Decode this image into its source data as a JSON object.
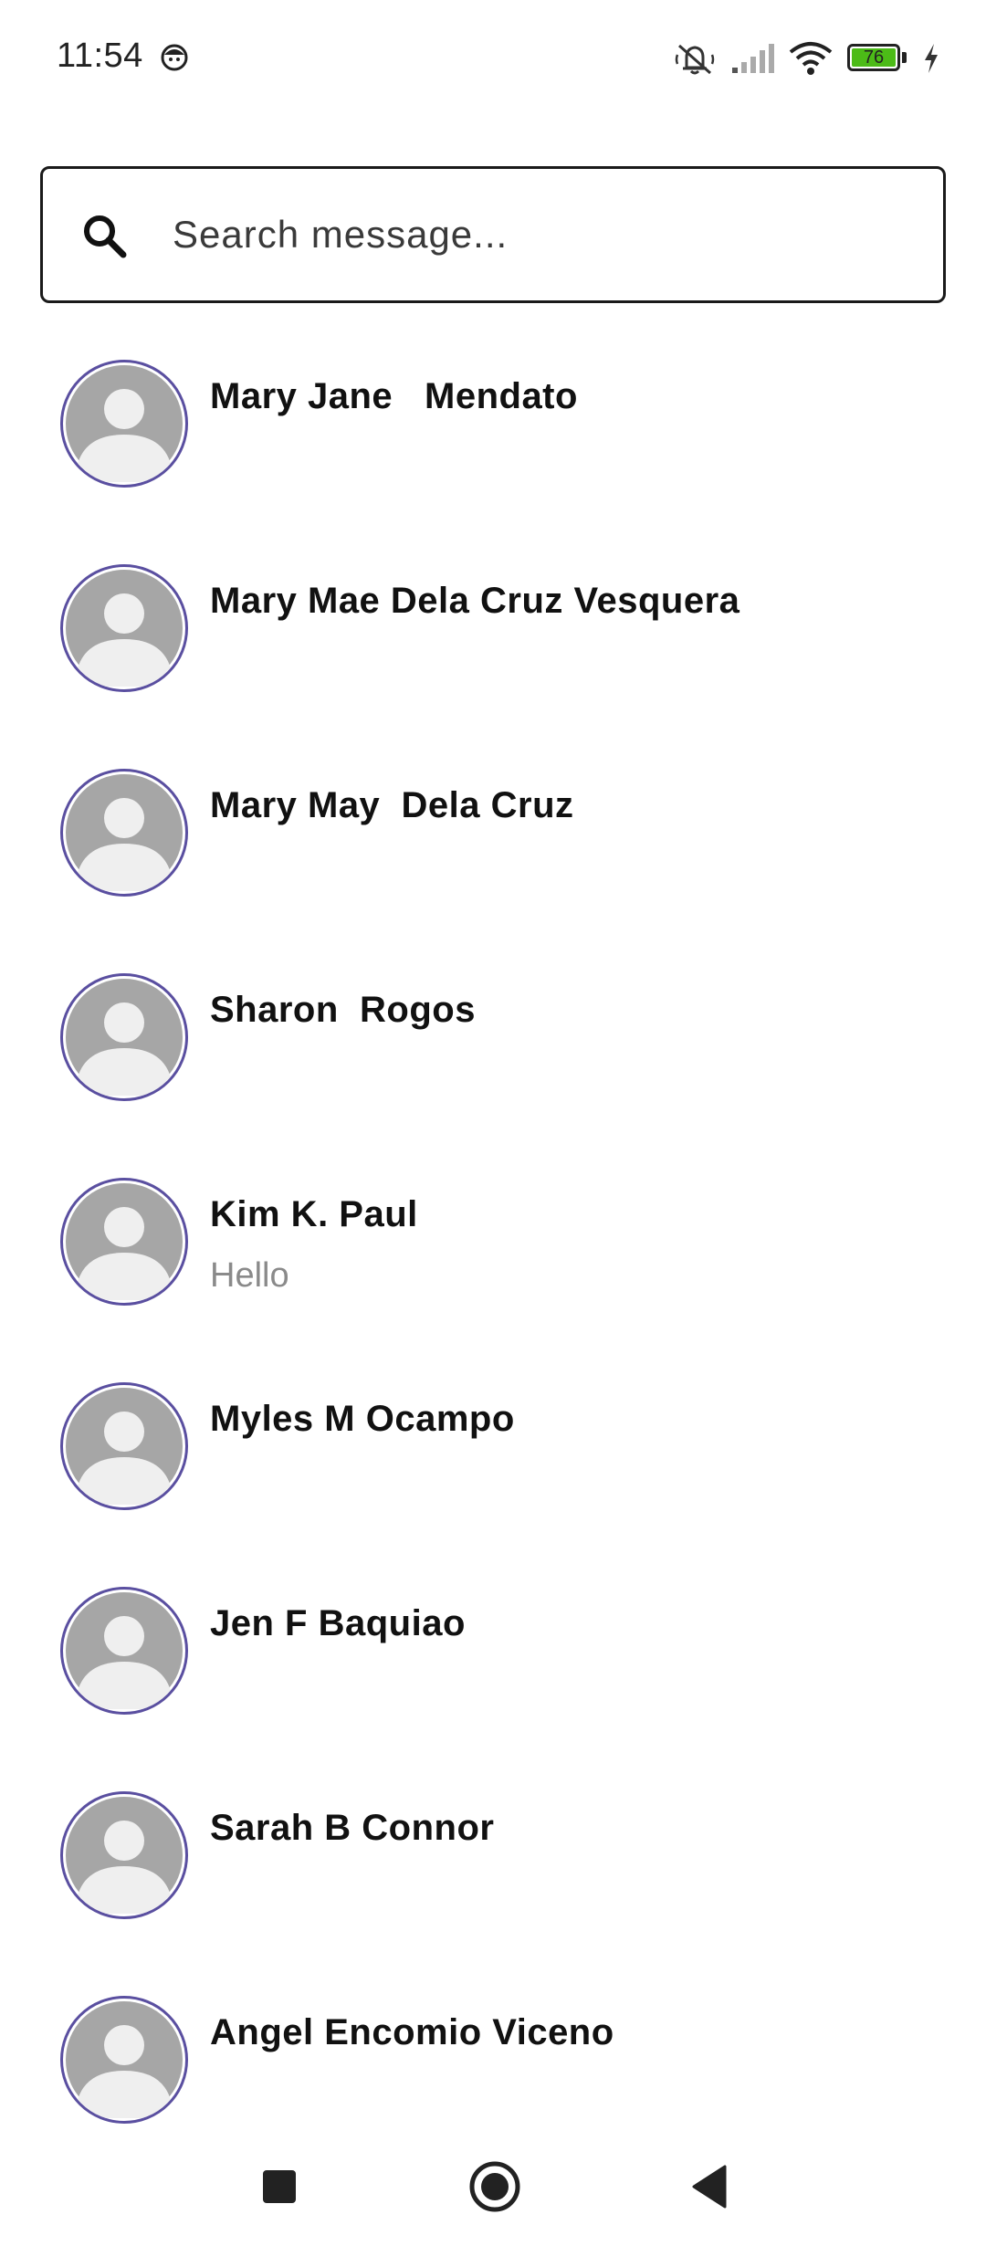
{
  "status_bar": {
    "time": "11:54",
    "battery_level": "76",
    "icons": [
      "face-notification-icon",
      "mute-icon",
      "signal-icon",
      "wifi-icon",
      "battery-icon",
      "charging-icon"
    ]
  },
  "search": {
    "placeholder": "Search message...",
    "value": ""
  },
  "contacts": [
    {
      "name": "Mary Jane   Mendato",
      "message": ""
    },
    {
      "name": "Mary Mae Dela Cruz Vesquera",
      "message": ""
    },
    {
      "name": "Mary May  Dela Cruz",
      "message": ""
    },
    {
      "name": "Sharon  Rogos",
      "message": ""
    },
    {
      "name": "Kim K. Paul",
      "message": "Hello"
    },
    {
      "name": "Myles M Ocampo",
      "message": ""
    },
    {
      "name": "Jen F Baquiao",
      "message": ""
    },
    {
      "name": "Sarah B Connor",
      "message": ""
    },
    {
      "name": "Angel Encomio Viceno",
      "message": ""
    }
  ],
  "colors": {
    "avatar_ring": "#5a4fa0",
    "avatar_bg": "#a6a6a6",
    "battery_fill": "#4cbb17"
  },
  "nav": {
    "buttons": [
      "recent-apps-icon",
      "home-icon",
      "back-icon"
    ]
  }
}
